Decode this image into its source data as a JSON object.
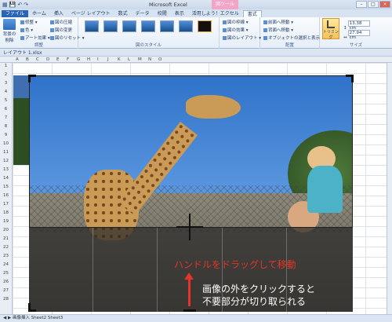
{
  "window": {
    "title": "Microsoft Excel",
    "context_tab_group": "図ツール"
  },
  "tabs": [
    "ファイル",
    "ホーム",
    "挿入",
    "ページ レイアウト",
    "数式",
    "データ",
    "校閲",
    "表示",
    "活用しよう！エクセル",
    "書式"
  ],
  "ribbon": {
    "adjust": {
      "label": "調整",
      "remove_bg": "背景の\n削除",
      "items": [
        "修整 ▾",
        "色 ▾",
        "アート効果 ▾"
      ],
      "items2": [
        "図の圧縮",
        "図の変更",
        "図のリセット ▾"
      ]
    },
    "styles": {
      "label": "図のスタイル",
      "items": [
        "図の枠線 ▾",
        "図の効果 ▾",
        "図のレイアウト ▾"
      ]
    },
    "arrange": {
      "label": "配置",
      "items": [
        "前面へ移動 ▾",
        "背面へ移動 ▾",
        "オブジェクトの選択と表示"
      ]
    },
    "size": {
      "label": "サイズ",
      "crop": "トリミング",
      "height": "13.38 cm",
      "width": "27.94 cm"
    }
  },
  "workbook": {
    "title": "レイアウト 1.xlsx"
  },
  "columns": [
    "A",
    "B",
    "C",
    "D",
    "E",
    "F",
    "G",
    "H",
    "I",
    "J",
    "K",
    "L",
    "M",
    "N",
    "O"
  ],
  "rows": [
    "1",
    "2",
    "3",
    "4",
    "5",
    "6",
    "7",
    "8",
    "9",
    "10",
    "11",
    "12",
    "13",
    "14",
    "15",
    "16",
    "17",
    "18",
    "19",
    "20",
    "21",
    "22",
    "23",
    "24",
    "25",
    "26",
    "27",
    "28"
  ],
  "annotation": {
    "drag_handle": "ハンドルをドラッグして移動",
    "click_outside_1": "画像の外をクリックすると",
    "click_outside_2": "不要部分が切り取られる"
  },
  "sheet_tabs": "◀ ▶  画像挿入  Sheet2  Sheet3",
  "colors": {
    "crop_note": "#e53527",
    "ribbon_tab_file": "#2a64b5",
    "context_tab": "#f3a5c8"
  }
}
